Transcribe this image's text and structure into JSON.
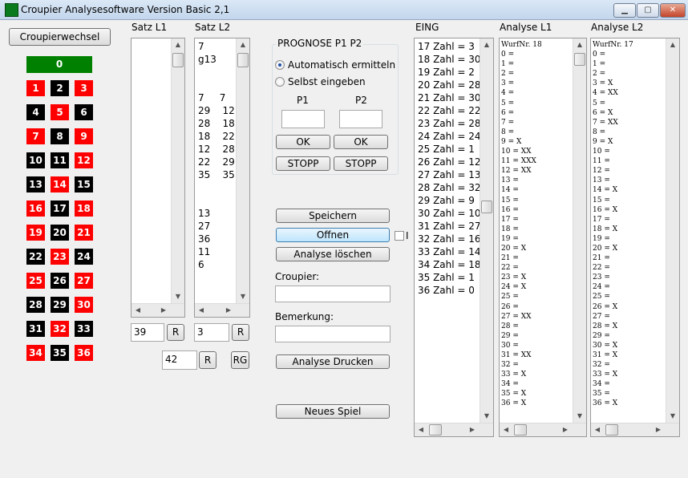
{
  "window": {
    "title": "Croupier Analysesoftware Version Basic 2,1",
    "minimize_icon": "minimize-icon",
    "maximize_icon": "maximize-icon",
    "close_icon": "close-icon"
  },
  "left": {
    "croupier_button": "Croupierwechsel",
    "zero": "0",
    "numbers": [
      {
        "n": "1",
        "c": "red"
      },
      {
        "n": "2",
        "c": "black"
      },
      {
        "n": "3",
        "c": "red"
      },
      {
        "n": "4",
        "c": "black"
      },
      {
        "n": "5",
        "c": "red"
      },
      {
        "n": "6",
        "c": "black"
      },
      {
        "n": "7",
        "c": "red"
      },
      {
        "n": "8",
        "c": "black"
      },
      {
        "n": "9",
        "c": "red"
      },
      {
        "n": "10",
        "c": "black"
      },
      {
        "n": "11",
        "c": "black"
      },
      {
        "n": "12",
        "c": "red"
      },
      {
        "n": "13",
        "c": "black"
      },
      {
        "n": "14",
        "c": "red"
      },
      {
        "n": "15",
        "c": "black"
      },
      {
        "n": "16",
        "c": "red"
      },
      {
        "n": "17",
        "c": "black"
      },
      {
        "n": "18",
        "c": "red"
      },
      {
        "n": "19",
        "c": "red"
      },
      {
        "n": "20",
        "c": "black"
      },
      {
        "n": "21",
        "c": "red"
      },
      {
        "n": "22",
        "c": "black"
      },
      {
        "n": "23",
        "c": "red"
      },
      {
        "n": "24",
        "c": "black"
      },
      {
        "n": "25",
        "c": "red"
      },
      {
        "n": "26",
        "c": "black"
      },
      {
        "n": "27",
        "c": "red"
      },
      {
        "n": "28",
        "c": "black"
      },
      {
        "n": "29",
        "c": "black"
      },
      {
        "n": "30",
        "c": "red"
      },
      {
        "n": "31",
        "c": "black"
      },
      {
        "n": "32",
        "c": "red"
      },
      {
        "n": "33",
        "c": "black"
      },
      {
        "n": "34",
        "c": "red"
      },
      {
        "n": "35",
        "c": "black"
      },
      {
        "n": "36",
        "c": "red"
      }
    ]
  },
  "satz_l1": {
    "label": "Satz L1",
    "lines": [],
    "count_value": "39",
    "r_button": "R"
  },
  "satz_l2": {
    "label": "Satz L2",
    "lines": [
      "7",
      "g13",
      "",
      "",
      "7     7",
      "29    12",
      "28    18",
      "18    22",
      "12    28",
      "22    29",
      "35    35",
      "",
      "",
      "13",
      "27",
      "36",
      "11",
      "6"
    ],
    "count_value": "3",
    "r_button": "R"
  },
  "bottom_left": {
    "value": "42",
    "r_button": "R",
    "rg_button": "RG"
  },
  "prognose": {
    "title": "PROGNOSE  P1  P2",
    "auto_label": "Automatisch ermitteln",
    "manual_label": "Selbst eingeben",
    "p1_label": "P1",
    "p2_label": "P2",
    "p1_value": "",
    "p2_value": "",
    "ok1": "OK",
    "ok2": "OK",
    "stopp1": "STOPP",
    "stopp2": "STOPP"
  },
  "actions": {
    "save": "Speichern",
    "open": "Offnen",
    "open_check_label": "I",
    "clear": "Analyse löschen",
    "croupier_label": "Croupier:",
    "croupier_value": "",
    "remark_label": "Bemerkung:",
    "remark_value": "",
    "print": "Analyse Drucken",
    "new_game": "Neues Spiel"
  },
  "eing": {
    "label": "EING",
    "lines": [
      "17 Zahl = 3",
      "18 Zahl = 30",
      "19 Zahl = 2",
      "20 Zahl = 28",
      "21 Zahl = 30",
      "22 Zahl = 22",
      "23 Zahl = 28",
      "24 Zahl = 24",
      "25 Zahl = 1",
      "26 Zahl = 12",
      "27 Zahl = 13",
      "28 Zahl = 32",
      "29 Zahl = 9",
      "30 Zahl = 10",
      "31 Zahl = 27",
      "32 Zahl = 16",
      "33 Zahl = 14",
      "34 Zahl = 18",
      "35 Zahl = 1",
      "36 Zahl = 0"
    ]
  },
  "analyse_l1": {
    "label": "Analyse L1",
    "lines": [
      "WurfNr. 18",
      "0 =",
      "1 =",
      "2 =",
      "3 =",
      "4 =",
      "5 =",
      "6 =",
      "7 =",
      "8 =",
      "9 = X",
      "10 = XX",
      "11 = XXX",
      "12 = XX",
      "13 =",
      "14 =",
      "15 =",
      "16 =",
      "17 =",
      "18 =",
      "19 =",
      "20 = X",
      "21 =",
      "22 =",
      "23 = X",
      "24 = X",
      "25 =",
      "26 =",
      "27 = XX",
      "28 =",
      "29 =",
      "30 =",
      "31 = XX",
      "32 =",
      "33 = X",
      "34 =",
      "35 = X",
      "36 = X"
    ]
  },
  "analyse_l2": {
    "label": "Analyse L2",
    "lines": [
      "WurfNr. 17",
      "0 =",
      "1 =",
      "2 =",
      "3 = X",
      "4 = XX",
      "5 =",
      "6 = X",
      "7 = XX",
      "8 =",
      "9 = X",
      "10 =",
      "11 =",
      "12 =",
      "13 =",
      "14 = X",
      "15 =",
      "16 = X",
      "17 =",
      "18 = X",
      "19 =",
      "20 = X",
      "21 =",
      "22 =",
      "23 =",
      "24 =",
      "25 =",
      "26 = X",
      "27 =",
      "28 = X",
      "29 =",
      "30 = X",
      "31 = X",
      "32 =",
      "33 = X",
      "34 =",
      "35 =",
      "36 = X"
    ]
  }
}
